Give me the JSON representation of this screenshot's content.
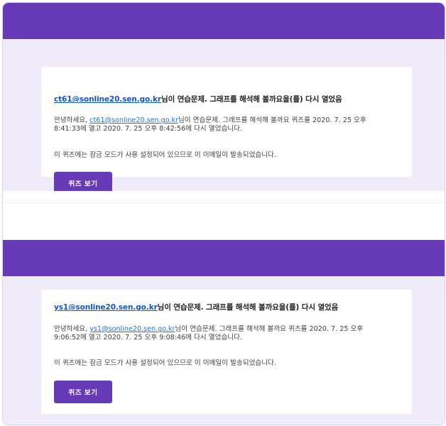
{
  "colors": {
    "brand": "#673ab7",
    "section_bg": "#f0ebf8",
    "link": "#1a73e8"
  },
  "emails": [
    {
      "heading_email": "ct61@sonline20.sen.go.kr",
      "heading_rest": "님이 연습문제. 그래프를 해석해 볼까요을(를) 다시 열었음",
      "body_prefix": "안녕하세요, ",
      "body_email": "ct61@sonline20.sen.go.kr",
      "body_line1_rest": "님이 연습문제. 그래프를 해석해 볼까요 퀴즈를 2020. 7. 25 오후",
      "body_line2": "8:41:33에 열고 2020. 7. 25 오후 8:42:56에 다시 열었습니다.",
      "notice": "이 퀴즈에는 잠금 모드가 사용 설정되어 있으므로 이 이메일이 발송되었습니다.",
      "button_label": "퀴즈 보기"
    },
    {
      "heading_email": "ys1@sonline20.sen.go.kr",
      "heading_rest": "님이 연습문제. 그래프를 해석해 볼까요을(를) 다시 열었음",
      "body_prefix": "안녕하세요, ",
      "body_email": "ys1@sonline20.sen.go.kr",
      "body_line1_rest": "님이 연습문제. 그래프를 해석해 볼까요 퀴즈를 2020. 7. 25 오후",
      "body_line2": "9:06:52에 열고 2020. 7. 25 오후 9:08:46에 다시 열었습니다.",
      "notice": "이 퀴즈에는 잠금 모드가 사용 설정되어 있으므로 이 이메일이 발송되었습니다.",
      "button_label": "퀴즈 보기"
    }
  ]
}
